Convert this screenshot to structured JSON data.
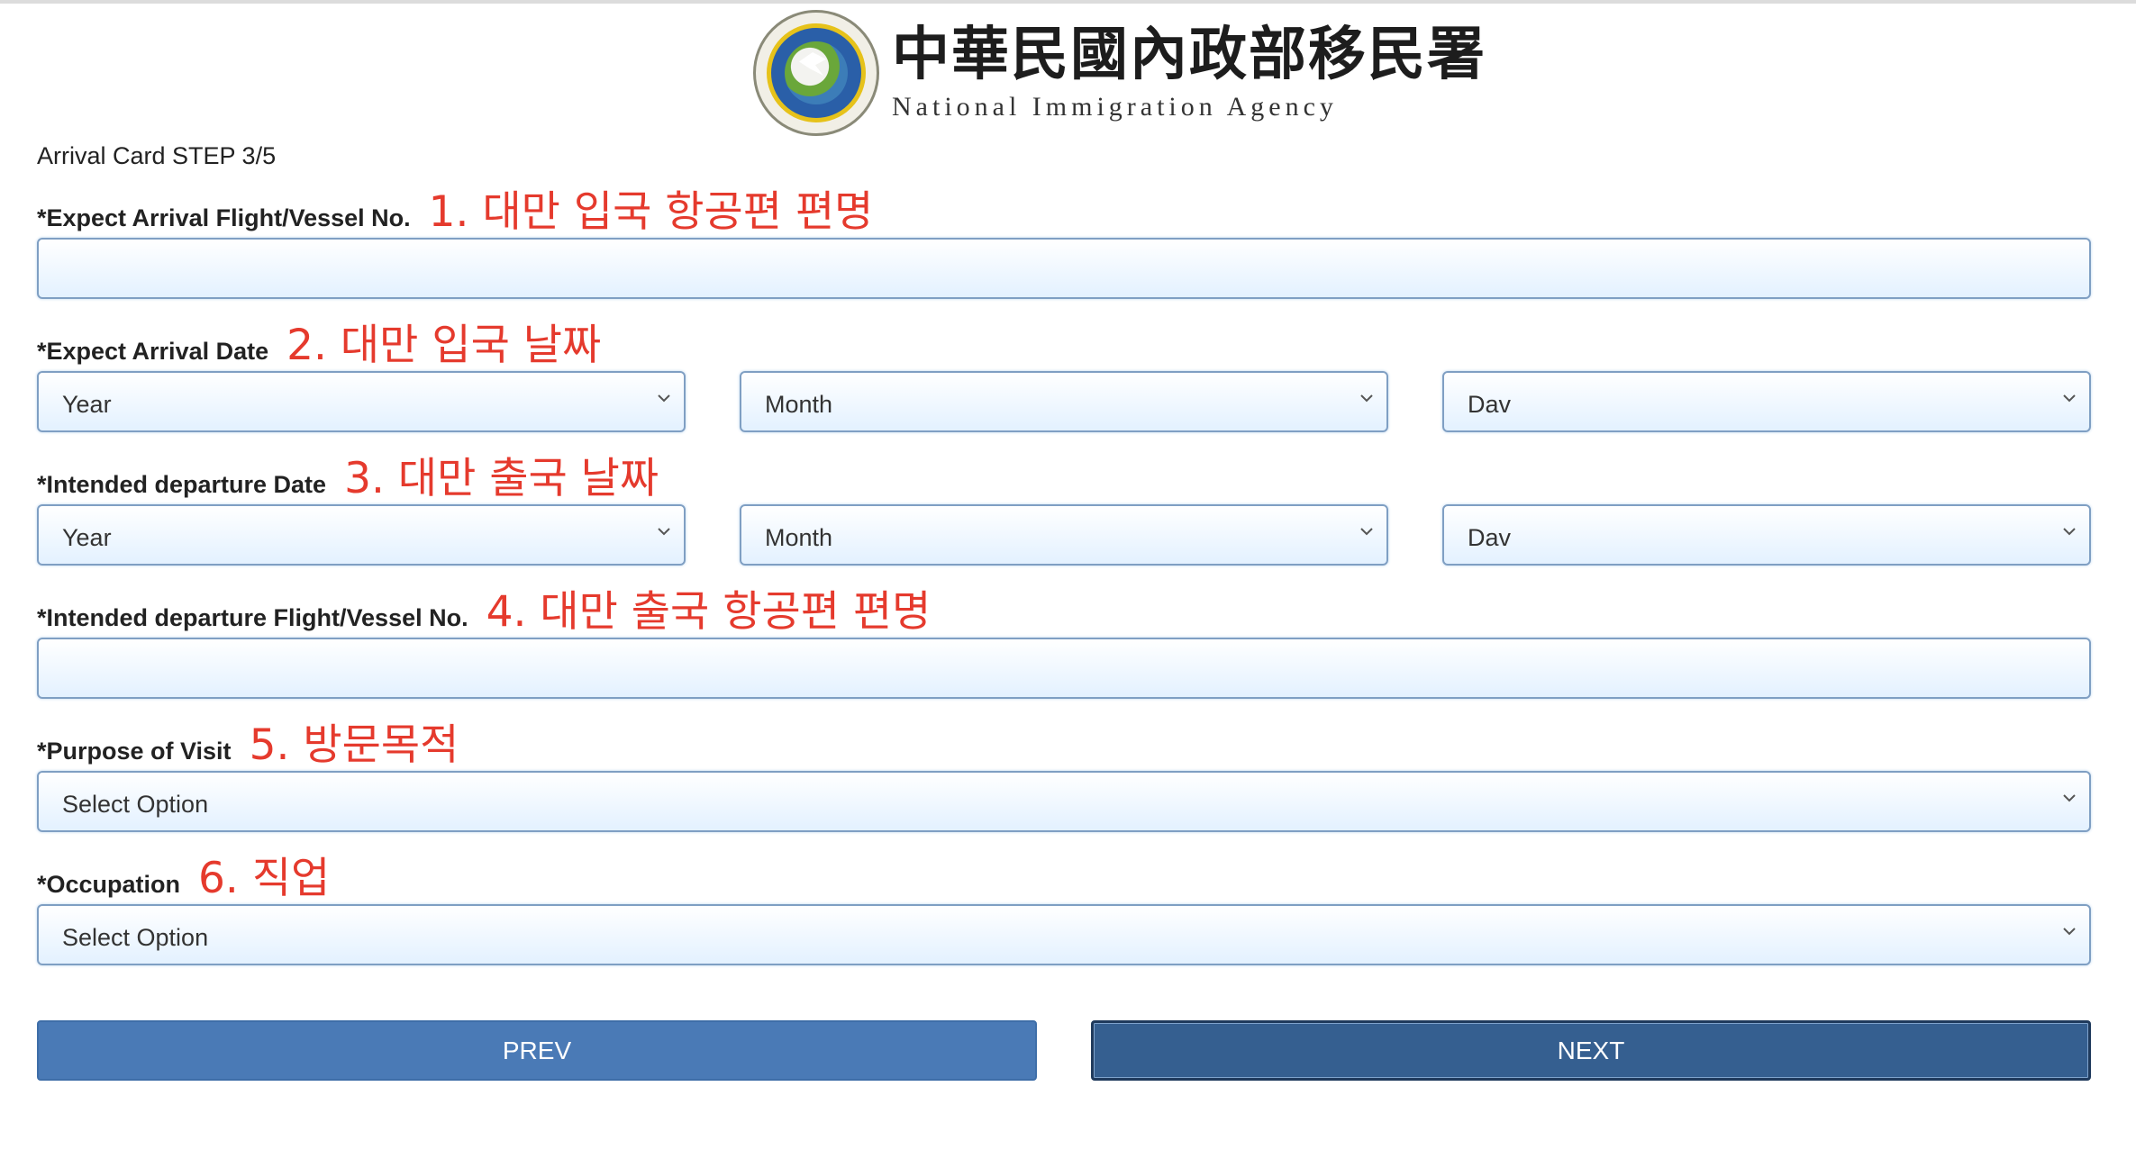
{
  "header": {
    "agency_cn": "中華民國內政部移民署",
    "agency_en": "National Immigration Agency"
  },
  "form": {
    "step_text": "Arrival Card STEP 3/5",
    "fields": {
      "arrival_flight": {
        "label": "*Expect Arrival Flight/Vessel No.",
        "note": "1. 대만 입국 항공편 편명",
        "value": ""
      },
      "arrival_date": {
        "label": "*Expect Arrival Date",
        "note": "2. 대만 입국 날짜",
        "year": "Year",
        "month": "Month",
        "day": "Dav"
      },
      "departure_date": {
        "label": "*Intended departure Date",
        "note": "3. 대만 출국 날짜",
        "year": "Year",
        "month": "Month",
        "day": "Dav"
      },
      "departure_flight": {
        "label": "*Intended departure Flight/Vessel No.",
        "note": "4. 대만 출국 항공편 편명",
        "value": ""
      },
      "purpose": {
        "label": "*Purpose of Visit",
        "note": "5. 방문목적",
        "value": "Select Option"
      },
      "occupation": {
        "label": "*Occupation",
        "note": "6. 직업",
        "value": "Select Option"
      }
    },
    "buttons": {
      "prev": "PREV",
      "next": "NEXT"
    }
  },
  "colors": {
    "annotation": "#e53a2d",
    "prev_button": "#4a7ab6",
    "next_button": "#355f90",
    "field_border": "#7f9fc3"
  },
  "icons": {
    "select_arrow": "chevron-down-icon",
    "logo": "agency-seal-logo"
  }
}
